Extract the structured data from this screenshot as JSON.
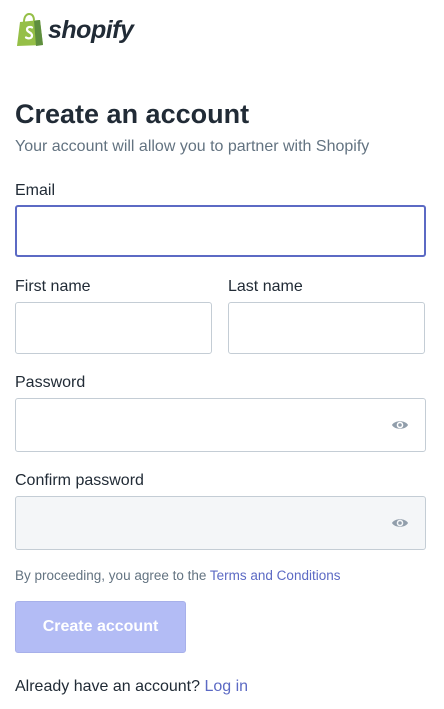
{
  "brand": {
    "name": "shopify",
    "logo_icon": "shopping-bag-icon",
    "logo_color": "#95bf47"
  },
  "heading": {
    "title": "Create an account",
    "subtitle": "Your account will allow you to partner with Shopify"
  },
  "fields": {
    "email": {
      "label": "Email",
      "value": "",
      "focused": true
    },
    "first_name": {
      "label": "First name",
      "value": ""
    },
    "last_name": {
      "label": "Last name",
      "value": ""
    },
    "password": {
      "label": "Password",
      "value": "",
      "icon": "eye-icon"
    },
    "confirm_password": {
      "label": "Confirm password",
      "value": "",
      "icon": "eye-icon",
      "disabled": true
    }
  },
  "terms": {
    "prefix": "By proceeding, you agree to the",
    "link": "Terms and Conditions"
  },
  "submit": {
    "label": "Create account",
    "disabled": true
  },
  "login": {
    "prompt": "Already have an account?",
    "link": "Log in"
  },
  "colors": {
    "accent": "#5c6ac4",
    "button_disabled": "#b3bcf5",
    "text": "#212b36",
    "muted": "#637381",
    "border": "#c4cdd5"
  }
}
